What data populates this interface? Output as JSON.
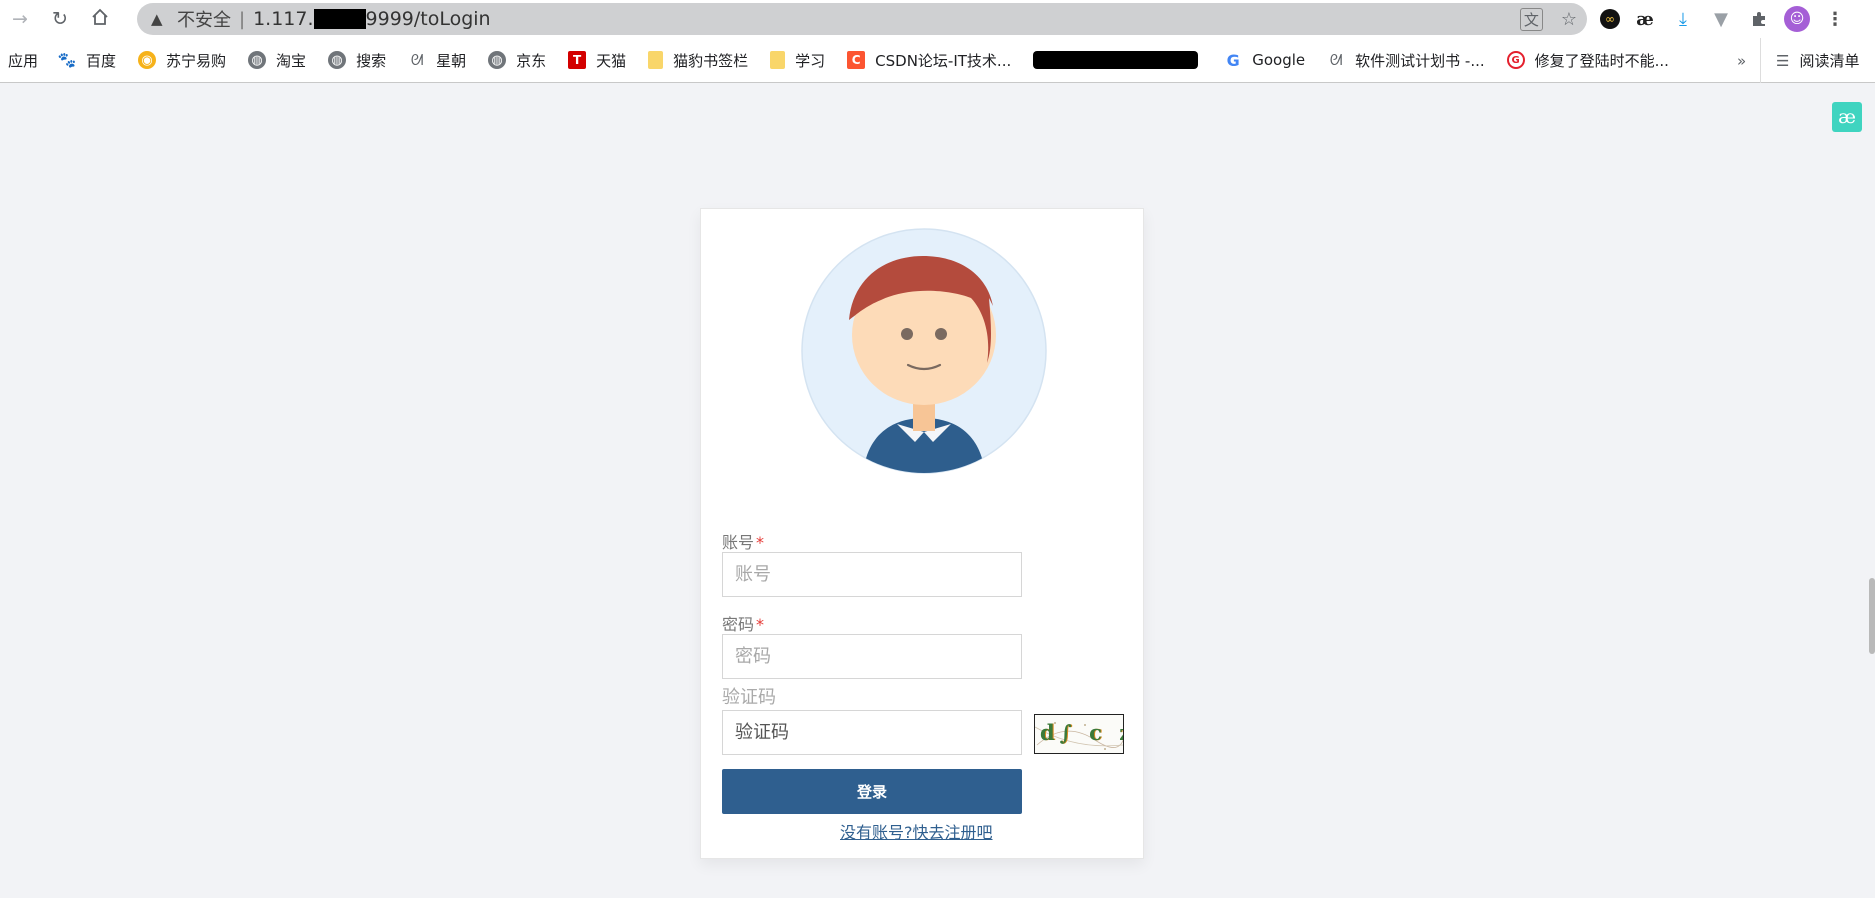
{
  "browser": {
    "back_icon": "arrow-right-icon",
    "reload_icon": "reload-icon",
    "home_icon": "home-icon",
    "security_label": "不安全",
    "separator": "|",
    "url_prefix": "1.117.",
    "url_suffix": "9999/toLogin",
    "extensions": [
      "infinity-icon",
      "ae-icon",
      "download-icon",
      "vuejs-icon",
      "puzzle-icon",
      "profile-icon",
      "more-icon"
    ]
  },
  "bookmarks": {
    "apps_label": "应用",
    "items": [
      {
        "label": "百度",
        "icon": "paw-icon"
      },
      {
        "label": "苏宁易购",
        "icon": "suning-icon"
      },
      {
        "label": "淘宝",
        "icon": "globe-icon"
      },
      {
        "label": "搜索",
        "icon": "globe-icon"
      },
      {
        "label": "星朝",
        "icon": "feather-icon"
      },
      {
        "label": "京东",
        "icon": "globe-icon"
      },
      {
        "label": "天猫",
        "icon": "tmall-icon"
      },
      {
        "label": "猫豹书签栏",
        "icon": "folder-icon"
      },
      {
        "label": "学习",
        "icon": "folder-icon"
      },
      {
        "label": "CSDN论坛-IT技术...",
        "icon": "csdn-icon"
      }
    ],
    "items_after_redaction": [
      {
        "label": "Google",
        "icon": "google-icon"
      },
      {
        "label": "软件测试计划书 -...",
        "icon": "feather-icon"
      },
      {
        "label": "修复了登陆时不能...",
        "icon": "red-g-icon"
      }
    ],
    "more_label": "»",
    "reading_list_label": "阅读清单"
  },
  "login": {
    "account_label": "账号",
    "account_placeholder": "账号",
    "password_label": "密码",
    "password_placeholder": "密码",
    "required_mark": "*",
    "captcha_label": "验证码",
    "captcha_placeholder": "验证码",
    "captcha_text": "d∫ c z",
    "login_button": "登录",
    "register_link": "没有账号?快去注册吧"
  },
  "colors": {
    "primary": "#2f5f8f",
    "required": "#e53935",
    "page_bg": "#f2f3f6"
  }
}
